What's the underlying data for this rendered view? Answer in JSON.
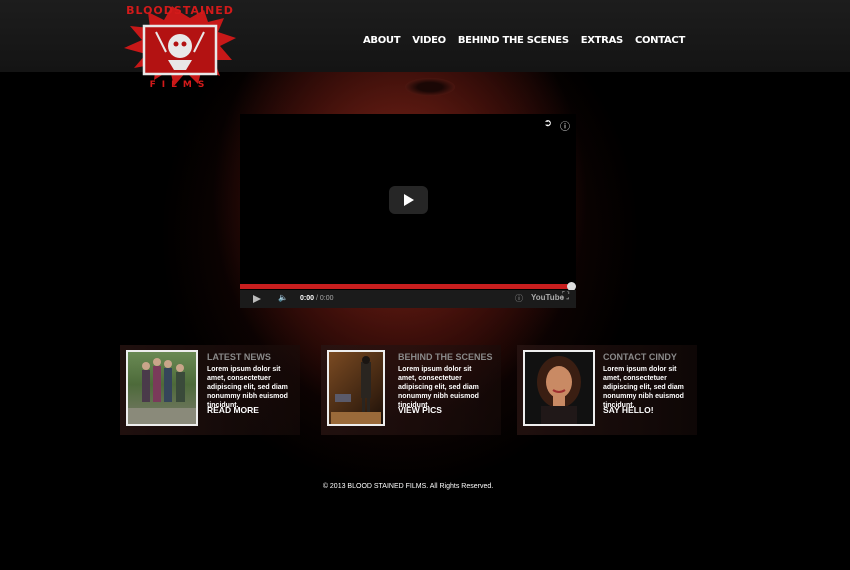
{
  "logo": {
    "top": "BLOODSTAINED",
    "bottom": "FILMS"
  },
  "nav": {
    "items": [
      "ABOUT",
      "VIDEO",
      "BEHIND THE SCENES",
      "EXTRAS",
      "CONTACT"
    ]
  },
  "player": {
    "time_current": "0:00",
    "time_total": "/ 0:00",
    "brand": "YouTube",
    "progress_fraction": 1.0
  },
  "panels": [
    {
      "title": "LATEST NEWS",
      "body": "Lorem ipsum dolor sit amet, consectetuer adipiscing elit, sed diam nonummy nibh euismod tincidunt.",
      "link": "READ MORE"
    },
    {
      "title": "BEHIND THE SCENES",
      "body": "Lorem ipsum dolor sit amet, consectetuer adipiscing elit, sed diam nonummy nibh euismod tincidunt.",
      "link": "VIEW PICS"
    },
    {
      "title": "CONTACT CINDY",
      "body": "Lorem ipsum dolor sit amet, consectetuer adipiscing elit, sed diam nonummy nibh euismod tincidunt.",
      "link": "SAY HELLO!"
    }
  ],
  "footer": {
    "text": "© 2013 BLOOD STAINED FILMS. All Rights Reserved."
  },
  "colors": {
    "accent": "#c81e1e",
    "header": "#1a1a1a",
    "panel_title": "#8a8a8a"
  }
}
